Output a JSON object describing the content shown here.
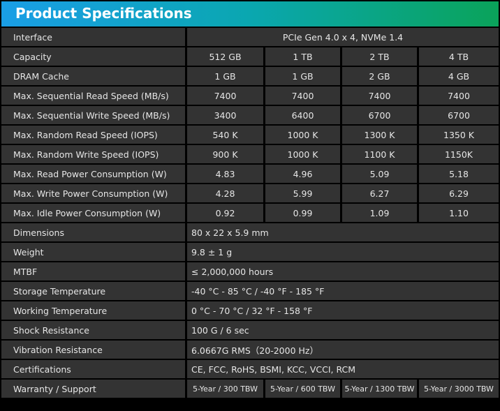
{
  "title": "Product Specifications",
  "rows": [
    {
      "label": "Interface",
      "span": "PCIe Gen 4.0 x 4, NVMe 1.4",
      "center": true
    },
    {
      "label": "Capacity",
      "values": [
        "512 GB",
        "1 TB",
        "2 TB",
        "4 TB"
      ]
    },
    {
      "label": "DRAM Cache",
      "values": [
        "1 GB",
        "1 GB",
        "2 GB",
        "4 GB"
      ]
    },
    {
      "label": "Max. Sequential Read Speed (MB/s)",
      "values": [
        "7400",
        "7400",
        "7400",
        "7400"
      ]
    },
    {
      "label": "Max. Sequential Write Speed (MB/s)",
      "values": [
        "3400",
        "6400",
        "6700",
        "6700"
      ]
    },
    {
      "label": "Max. Random Read Speed (IOPS)",
      "values": [
        "540 K",
        "1000 K",
        "1300 K",
        "1350 K"
      ]
    },
    {
      "label": "Max. Random Write Speed (IOPS)",
      "values": [
        "900 K",
        "1000 K",
        "1100 K",
        "1150K"
      ]
    },
    {
      "label": "Max. Read Power Consumption (W)",
      "values": [
        "4.83",
        "4.96",
        "5.09",
        "5.18"
      ]
    },
    {
      "label": "Max. Write Power Consumption (W)",
      "values": [
        "4.28",
        "5.99",
        "6.27",
        "6.29"
      ]
    },
    {
      "label": "Max. Idle Power Consumption (W)",
      "values": [
        "0.92",
        "0.99",
        "1.09",
        "1.10"
      ]
    },
    {
      "label": "Dimensions",
      "span": "80 x 22 x 5.9 mm"
    },
    {
      "label": "Weight",
      "span": "9.8 ± 1 g"
    },
    {
      "label": "MTBF",
      "span": "≤ 2,000,000 hours"
    },
    {
      "label": "Storage Temperature",
      "span": "-40 °C - 85 °C / -40 °F - 185 °F"
    },
    {
      "label": "Working Temperature",
      "span": "0 °C - 70 °C / 32 °F - 158 °F"
    },
    {
      "label": "Shock Resistance",
      "span": "100 G / 6 sec"
    },
    {
      "label": "Vibration Resistance",
      "span": "6.0667G RMS（20-2000 Hz）"
    },
    {
      "label": "Certifications",
      "span": "CE, FCC, RoHS, BSMI, KCC, VCCI, RCM"
    },
    {
      "label": "Warranty / Support",
      "values": [
        "5-Year / 300 TBW",
        "5-Year / 600 TBW",
        "5-Year / 1300 TBW",
        "5-Year / 3000 TBW"
      ],
      "small": true
    }
  ]
}
